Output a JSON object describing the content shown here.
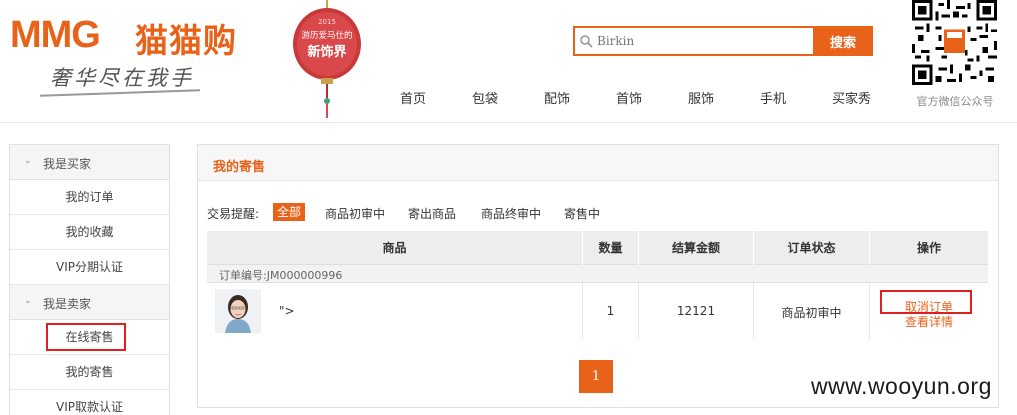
{
  "header": {
    "logo_en": "MMG",
    "logo_cn": "猫猫购",
    "slogan": "奢华尽在我手",
    "lantern_year": "2015",
    "lantern_line1": "游历爱马仕的",
    "lantern_line2": "新饰界",
    "search_placeholder": "Birkin",
    "search_button": "搜索",
    "qr_caption": "官方微信公众号"
  },
  "nav": [
    "首页",
    "包袋",
    "配饰",
    "首饰",
    "服饰",
    "手机",
    "买家秀"
  ],
  "sidebar": {
    "buyer_group": "我是买家",
    "buyer_items": [
      "我的订单",
      "我的收藏",
      "VIP分期认证"
    ],
    "seller_group": "我是卖家",
    "seller_items": [
      "在线寄售",
      "我的寄售",
      "VIP取款认证"
    ]
  },
  "panel": {
    "title": "我的寄售",
    "filter_title": "交易提醒:",
    "filters": [
      "全部",
      "商品初审中",
      "寄出商品",
      "商品终审中",
      "寄售中"
    ],
    "active_filter": "全部",
    "columns": [
      "商品",
      "数量",
      "结算金额",
      "订单状态",
      "操作"
    ],
    "orders": [
      {
        "order_no_label": "订单编号:JM000000996",
        "product_name": "\">",
        "quantity": "1",
        "amount": "12121",
        "status": "商品初审中",
        "action_cancel": "取消订单",
        "action_detail": "查看详情"
      }
    ],
    "pagination": [
      "1"
    ]
  },
  "watermark": "www.wooyun.org",
  "colors": {
    "accent": "#e8621a",
    "highlight_box": "#e02020"
  }
}
